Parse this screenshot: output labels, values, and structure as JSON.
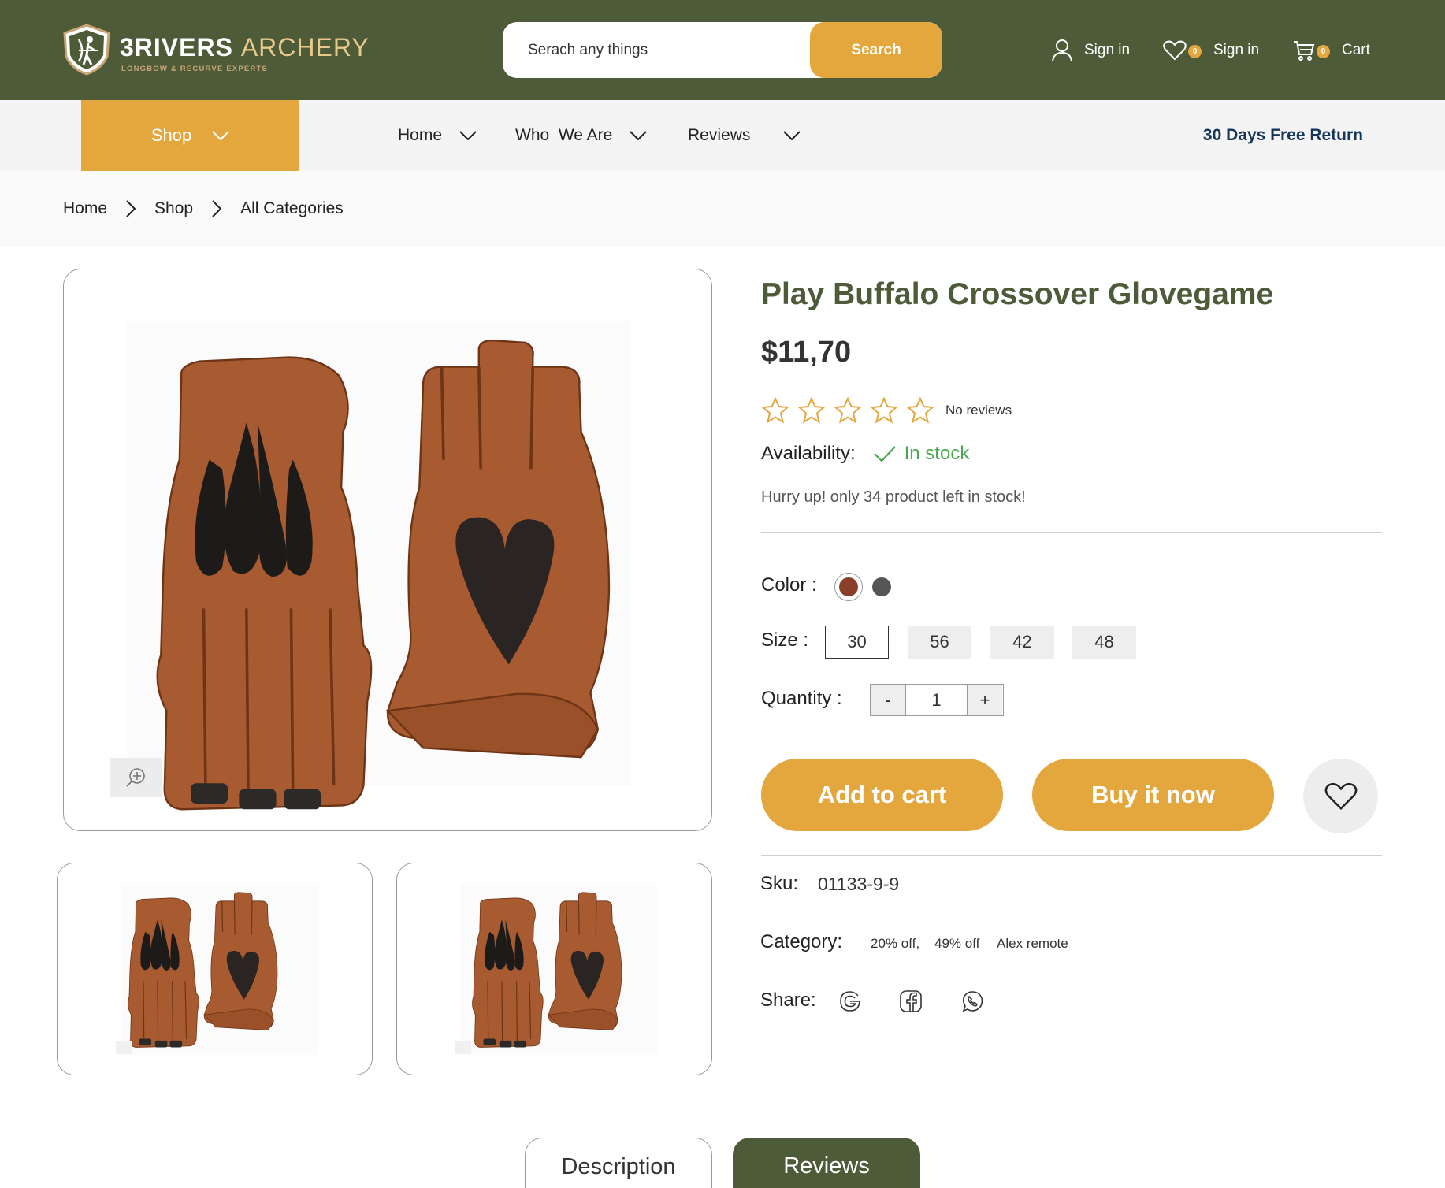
{
  "header": {
    "logo": {
      "title_bold": "3RIVERS",
      "title_thin": "ARCHERY",
      "tagline": "LONGBOW & RECURVE EXPERTS"
    },
    "search": {
      "placeholder": "Serach any things",
      "button_label": "Search"
    },
    "account_label": "Sign in",
    "wishlist": {
      "label": "Sign in",
      "count": "0"
    },
    "cart": {
      "label": "Cart",
      "count": "0"
    }
  },
  "nav": {
    "shop_label": "Shop",
    "items": [
      {
        "label": "Home"
      },
      {
        "label": "Who  We Are"
      },
      {
        "label": "Reviews"
      }
    ],
    "promo": "30 Days Free Return"
  },
  "breadcrumb": [
    "Home",
    "Shop",
    "All Categories"
  ],
  "product": {
    "title": "Play Buffalo Crossover Glovegame",
    "price": "$11,70",
    "rating": {
      "stars": 0,
      "max": 5,
      "text": "No reviews"
    },
    "availability": {
      "label": "Availability:",
      "status": "In stock"
    },
    "stock_note": "Hurry up! only 34 product left in stock!",
    "color": {
      "label": "Color :",
      "options": [
        "#8a3f2a",
        "#555555"
      ],
      "selected": 0
    },
    "size": {
      "label": "Size :",
      "options": [
        "30",
        "56",
        "42",
        "48"
      ],
      "selected": "30"
    },
    "quantity": {
      "label": "Quantity :",
      "value": "1",
      "minus": "-",
      "plus": "+"
    },
    "add_to_cart_label": "Add to cart",
    "buy_now_label": "Buy it now",
    "sku": {
      "label": "Sku:",
      "value": "01133-9-9"
    },
    "category": {
      "label": "Category:",
      "items": [
        "20% off,",
        "49% off",
        "Alex remote"
      ]
    },
    "share": {
      "label": "Share:",
      "icons": [
        "google-icon",
        "facebook-icon",
        "whatsapp-icon"
      ]
    }
  },
  "tabs": [
    {
      "label": "Description",
      "active": false
    },
    {
      "label": "Reviews",
      "active": true
    }
  ],
  "colors": {
    "brand_green": "#4d5b39",
    "accent_orange": "#e4a73e",
    "promo_navy": "#15365a",
    "stock_green": "#4aa84f",
    "leather_brown": "#a85a30"
  }
}
